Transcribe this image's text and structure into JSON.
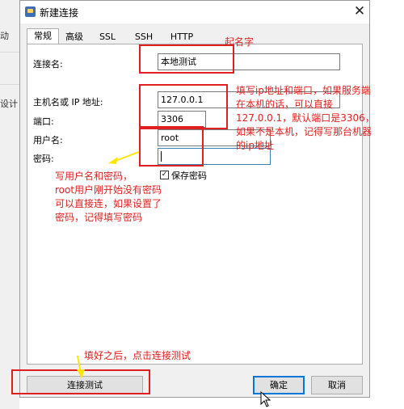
{
  "background_app": {
    "text_1": "动",
    "text_2": "设计"
  },
  "dialog": {
    "title": "新建连接",
    "tabs": [
      {
        "label": "常规",
        "active": true
      },
      {
        "label": "高级",
        "active": false
      },
      {
        "label": "SSL",
        "active": false
      },
      {
        "label": "SSH",
        "active": false
      },
      {
        "label": "HTTP",
        "active": false
      }
    ],
    "form": {
      "connection_name_label": "连接名:",
      "connection_name_value": "本地测试",
      "host_label": "主机名或 IP 地址:",
      "host_value": "127.0.0.1",
      "port_label": "端口:",
      "port_value": "3306",
      "username_label": "用户名:",
      "username_value": "root",
      "password_label": "密码:",
      "password_value": "",
      "save_password_label": "保存密码",
      "save_password_checked": true
    },
    "buttons": {
      "test": "连接测试",
      "ok": "确定",
      "cancel": "取消"
    }
  },
  "annotations": {
    "name_note": "起名字",
    "host_note": [
      "填写ip地址和端口，如果服务端",
      "在本机的话，可以直接",
      "127.0.0.1，默认端口是3306，",
      "如果不是本机，记得写那台机器",
      "的ip地址"
    ],
    "user_note": [
      "写用户名和密码，",
      "root用户刚开始没有密码",
      "可以直接连，如果设置了",
      "密码，记得填写密码"
    ],
    "test_note": "填好之后，点击连接测试",
    "colors": {
      "annotation": "#e02020",
      "arrow": "#ffe600",
      "default_button": "#0078d7"
    }
  }
}
